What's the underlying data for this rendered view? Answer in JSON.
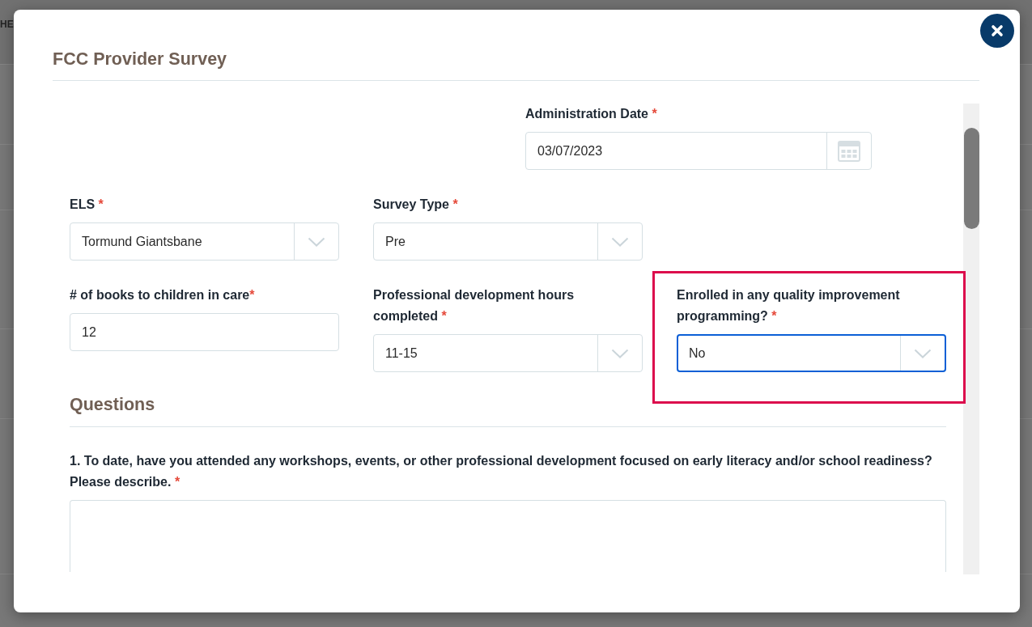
{
  "background_page": {
    "heading_fragment": "HE"
  },
  "dialog": {
    "title": "FCC Provider Survey"
  },
  "form": {
    "rows": [
      {
        "fields": [
          {
            "kind": "date",
            "label": "Administration Date",
            "required_mark": "*",
            "mark_spaced": true,
            "value": "03/07/2023",
            "focused": false,
            "highlighted": false
          }
        ]
      },
      {
        "fields": [
          {
            "kind": "select",
            "label": "ELS",
            "required_mark": "*",
            "mark_spaced": true,
            "value": "Tormund Giantsbane",
            "focused": false,
            "highlighted": false
          },
          {
            "kind": "select",
            "label": "Survey Type",
            "required_mark": "*",
            "mark_spaced": true,
            "value": "Pre",
            "focused": false,
            "highlighted": false
          }
        ]
      },
      {
        "fields": [
          {
            "kind": "text",
            "label": "# of books to children in care",
            "required_mark": "*",
            "mark_spaced": false,
            "value": "12",
            "focused": false,
            "highlighted": false
          },
          {
            "kind": "select",
            "label": "Professional development hours completed",
            "required_mark": "*",
            "mark_spaced": true,
            "value": "11-15",
            "focused": false,
            "highlighted": false
          },
          {
            "kind": "select",
            "label": "Enrolled in any quality improvement programming?",
            "required_mark": "*",
            "mark_spaced": true,
            "value": "No",
            "focused": true,
            "highlighted": true
          }
        ]
      }
    ]
  },
  "questions": {
    "heading": "Questions",
    "items": [
      {
        "text": "1. To date, have you attended any workshops, events, or other professional development focused on early literacy and/or school readiness? Please describe.",
        "required_mark": "*",
        "mark_spaced": true
      }
    ]
  }
}
